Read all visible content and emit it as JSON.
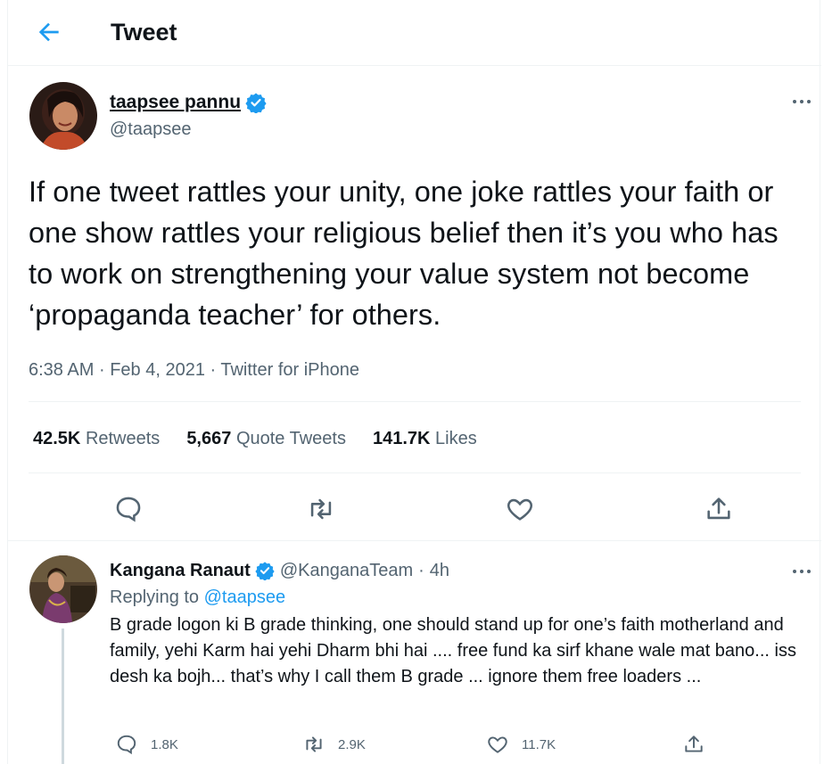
{
  "header": {
    "title": "Tweet"
  },
  "tweet": {
    "author_name": "taapsee pannu",
    "author_handle": "@taapsee",
    "text": "If one tweet rattles your unity, one joke rattles your faith or one show rattles your religious belief then it’s you who has to work on strengthening your value system not become ‘propaganda teacher’ for others.",
    "time": "6:38 AM",
    "date": "Feb 4, 2021",
    "source": "Twitter for iPhone",
    "separator": "·",
    "stats": {
      "retweets_count": "42.5K",
      "retweets_label": "Retweets",
      "quotes_count": "5,667",
      "quotes_label": "Quote Tweets",
      "likes_count": "141.7K",
      "likes_label": "Likes"
    }
  },
  "reply": {
    "author_name": "Kangana Ranaut",
    "author_handle": "@KanganaTeam",
    "time": "4h",
    "separator": "·",
    "replying_prefix": "Replying to",
    "replying_to": "@taapsee",
    "text": "B grade logon ki B grade thinking, one should stand up for one’s faith motherland and family, yehi Karm hai yehi Dharm bhi hai .... free fund ka sirf khane wale mat bano... iss desh ka bojh... that’s why I call them B grade ... ignore them free loaders ...",
    "replies": "1.8K",
    "retweets": "2.9K",
    "likes": "11.7K"
  },
  "colors": {
    "accent": "#1d9bf0",
    "secondary_text": "#536471",
    "primary_text": "#0f1419"
  },
  "icons": [
    "back-arrow-icon",
    "verified-badge-icon",
    "more-icon",
    "reply-icon",
    "retweet-icon",
    "like-icon",
    "share-icon"
  ]
}
